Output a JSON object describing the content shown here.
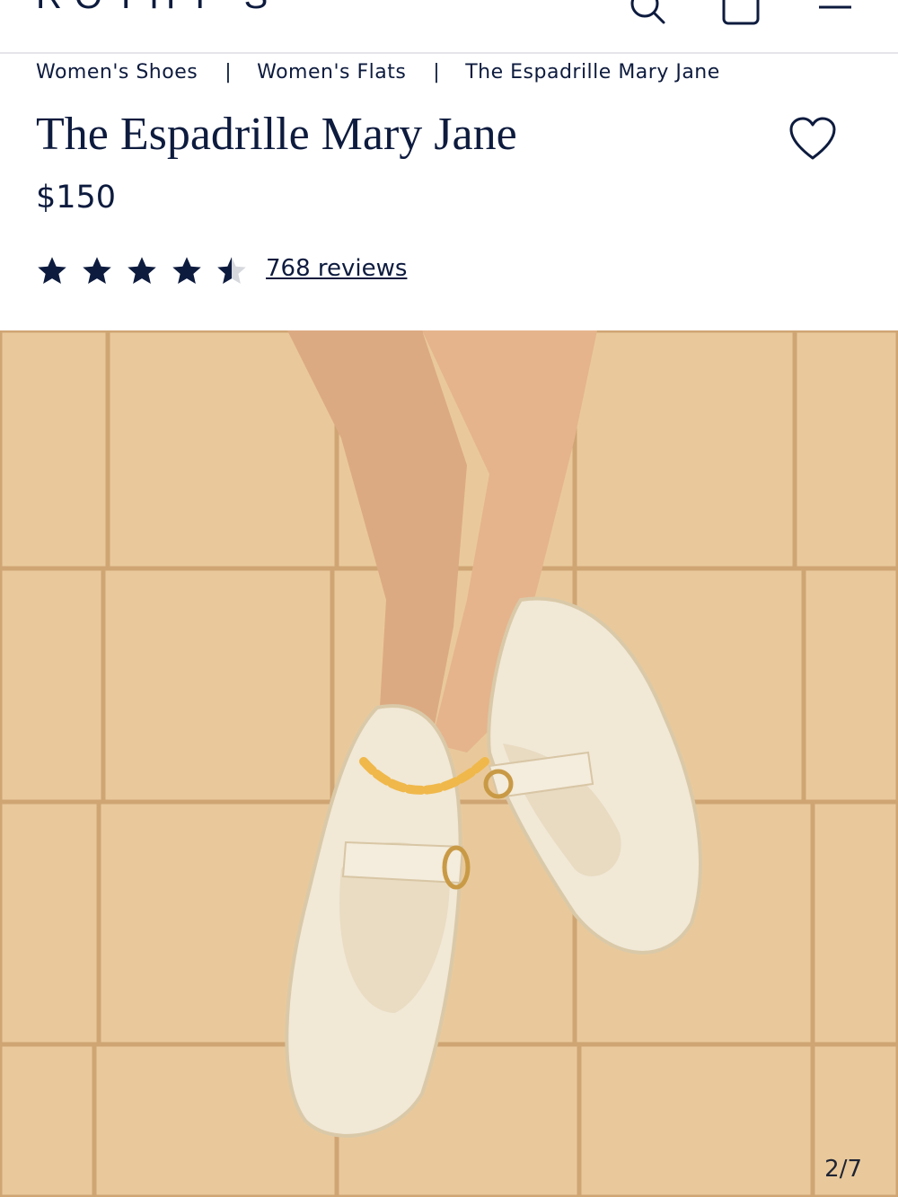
{
  "header": {
    "brand": "ROTHY'S",
    "icons": [
      "search-icon",
      "bag-icon",
      "menu-icon"
    ]
  },
  "breadcrumb": {
    "items": [
      "Women's Shoes",
      "Women's Flats",
      "The Espadrille Mary Jane"
    ],
    "separator": "|"
  },
  "product": {
    "title": "The Espadrille Mary Jane",
    "price": "$150",
    "rating": 4.5,
    "rating_max": 5,
    "reviews_label": "768 reviews"
  },
  "gallery": {
    "counter": "2/7",
    "current": 2,
    "total": 7
  },
  "colors": {
    "navy": "#0d1b3e",
    "tile": "#e2bf8f",
    "shoe": "#f1e8d6"
  }
}
